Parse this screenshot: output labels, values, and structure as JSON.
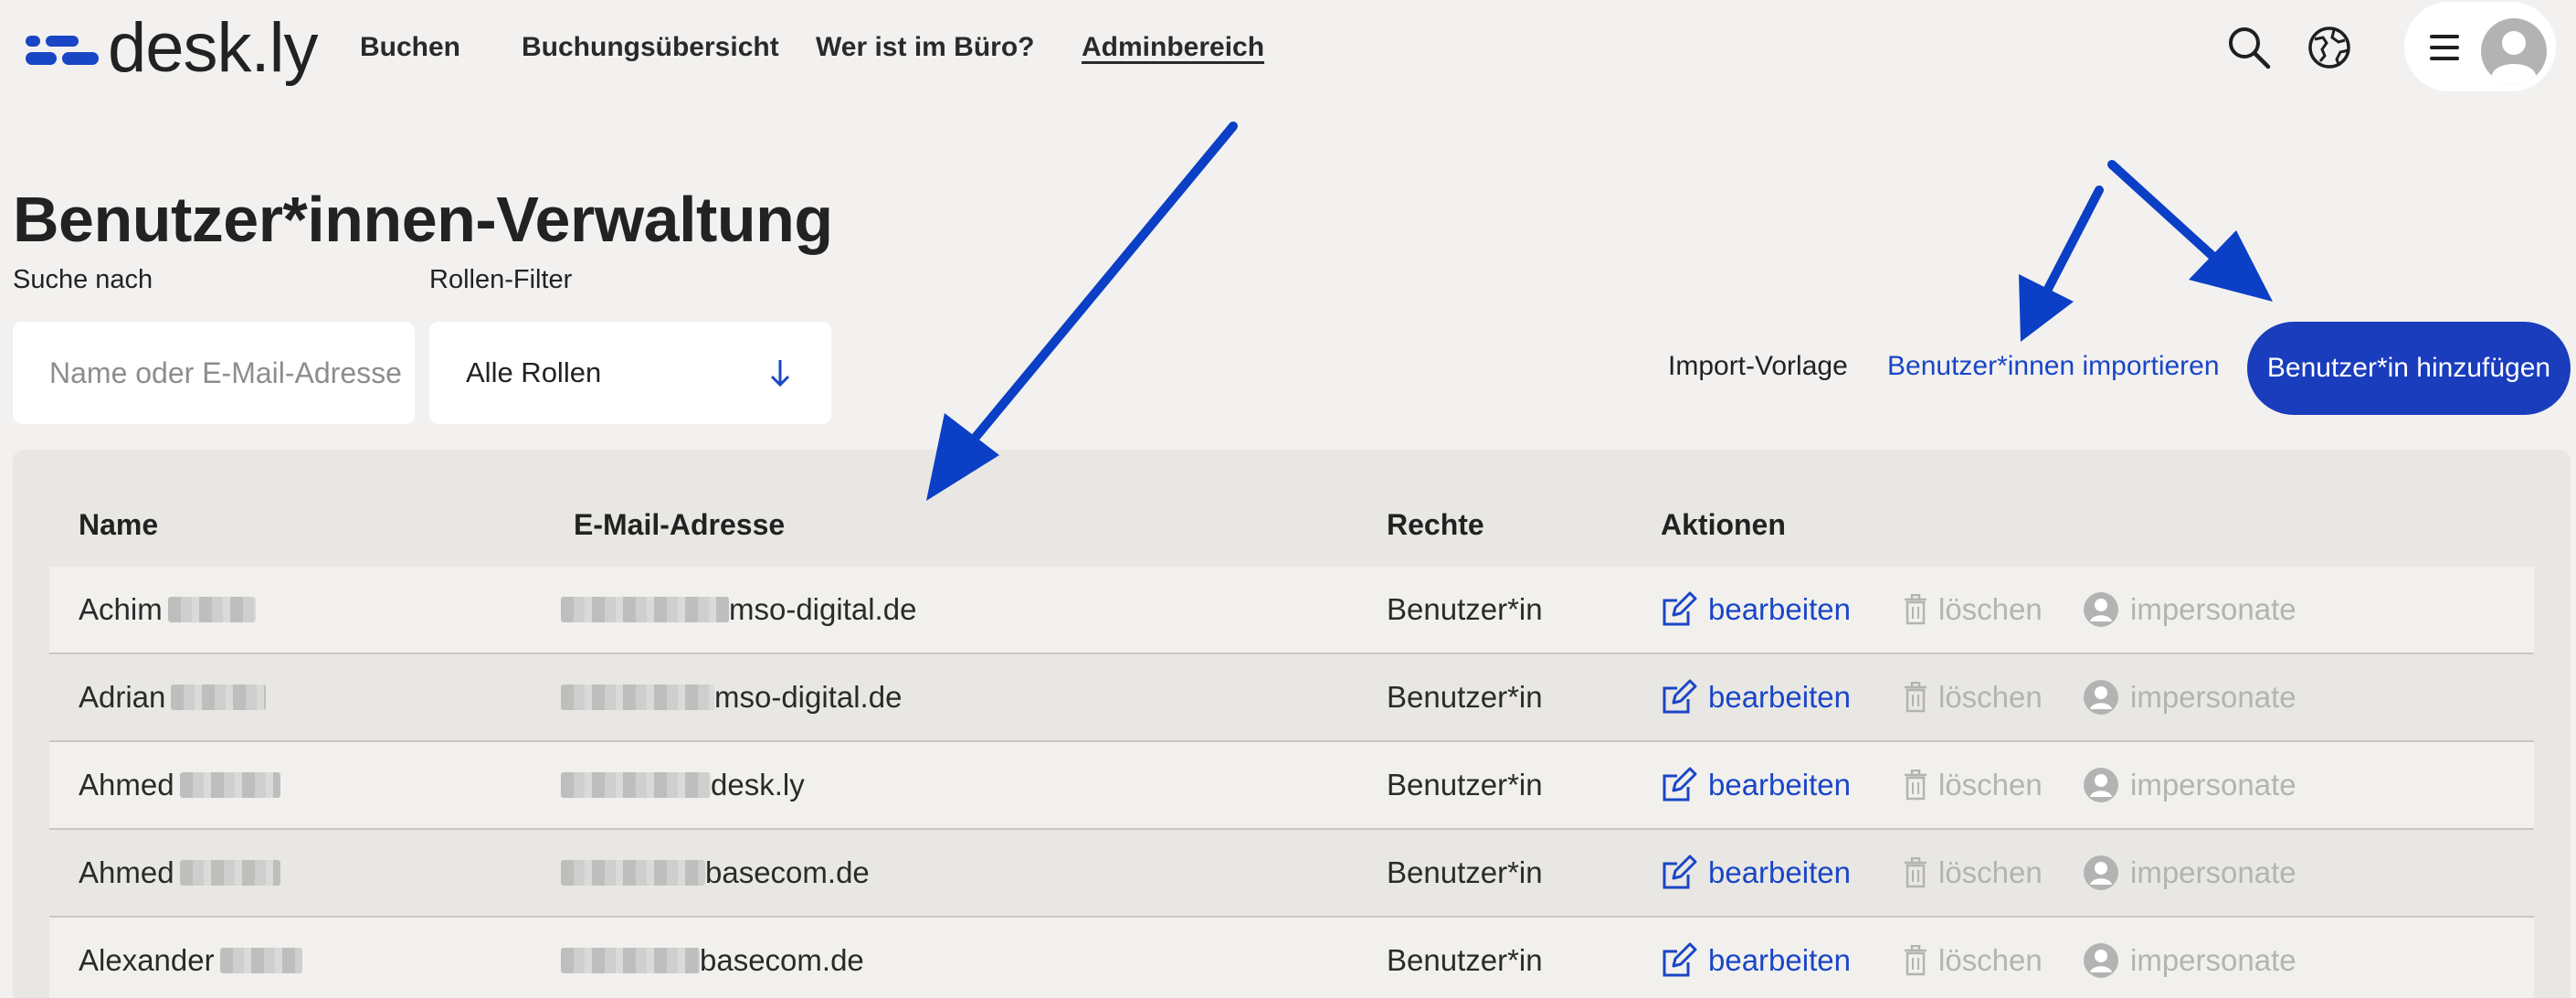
{
  "header": {
    "logo_text": "desk.ly",
    "nav": [
      {
        "label": "Buchen"
      },
      {
        "label": "Buchungsübersicht"
      },
      {
        "label": "Wer ist im Büro?"
      },
      {
        "label": "Adminbereich",
        "active": true
      }
    ],
    "icons": [
      "search-icon",
      "globe-icon",
      "hamburger-icon",
      "avatar-icon"
    ]
  },
  "page": {
    "title": "Benutzer*innen-Verwaltung"
  },
  "filters": {
    "search_label": "Suche nach",
    "search_placeholder": "Name oder E-Mail-Adresse",
    "search_value": "",
    "role_label": "Rollen-Filter",
    "role_value": "Alle Rollen"
  },
  "actions": {
    "import_template": "Import-Vorlage",
    "import_users": "Benutzer*innen importieren",
    "add_user": "Benutzer*in hinzufügen"
  },
  "table": {
    "headers": [
      "Name",
      "E-Mail-Adresse",
      "Rechte",
      "Aktionen"
    ],
    "action_labels": {
      "edit": "bearbeiten",
      "delete": "löschen",
      "impersonate": "impersonate"
    },
    "rows": [
      {
        "first_name": "Achim",
        "email_domain": "mso-digital.de",
        "role": "Benutzer*in"
      },
      {
        "first_name": "Adrian",
        "email_domain": "mso-digital.de",
        "role": "Benutzer*in"
      },
      {
        "first_name": "Ahmed",
        "email_domain": "desk.ly",
        "role": "Benutzer*in"
      },
      {
        "first_name": "Ahmed",
        "email_domain": "basecom.de",
        "role": "Benutzer*in"
      },
      {
        "first_name": "Alexander",
        "email_domain": "basecom.de",
        "role": "Benutzer*in"
      }
    ]
  },
  "colors": {
    "brand": "#1a3dbd",
    "link": "#1a46c6",
    "background": "#f2f1ef",
    "disabled": "#b3b3b3",
    "annotation_arrow": "#0a3fc6"
  }
}
